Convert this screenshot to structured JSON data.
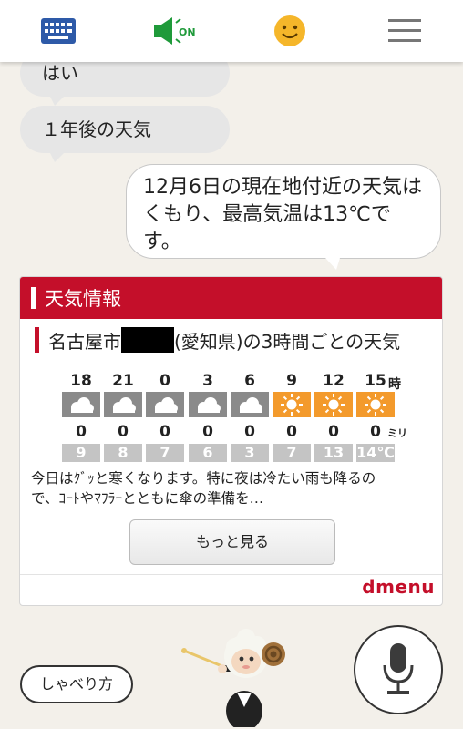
{
  "top_bar": {
    "icons": [
      "keyboard-icon",
      "speaker-icon",
      "smiley-icon",
      "hamburger-menu-icon"
    ],
    "speaker_state": "ON"
  },
  "conversation": {
    "user_bubble_1": "はい",
    "user_bubble_2": "１年後の天気",
    "reply_line_1": "12月6日の現在地付近の天気は",
    "reply_line_2": "くもり、最高気温は13℃で",
    "reply_line_3": "す。"
  },
  "weather_card": {
    "header": "天気情報",
    "city_prefix": "名古屋市",
    "city_suffix": "(愛知県)の3時間ごとの天気",
    "hour_unit": "時",
    "rain_unit": "ミリ",
    "hours": [
      "18",
      "21",
      "0",
      "3",
      "6",
      "9",
      "12",
      "15"
    ],
    "conditions": [
      "cloudy",
      "cloudy",
      "cloudy",
      "cloudy",
      "cloudy",
      "sunny",
      "sunny",
      "sunny"
    ],
    "rain": [
      "0",
      "0",
      "0",
      "0",
      "0",
      "0",
      "0",
      "0"
    ],
    "temps": [
      "9",
      "8",
      "7",
      "6",
      "3",
      "7",
      "13",
      "14℃"
    ],
    "description_line_1": "今日はｸﾞｯと寒くなります。特に夜は冷たい雨も降るの",
    "description_line_2": "で、ｺｰﾄやﾏﾌﾗｰとともに傘の準備を…",
    "more_button": "もっと見る",
    "brand": "dmenu",
    "colors": {
      "header": "#c40f2a",
      "cloudy": "#8a8a8a",
      "sunny": "#f39a2c"
    }
  },
  "bottom": {
    "howto_button": "しゃべり方",
    "mic_icon": "microphone-icon",
    "mascot": "sheep-mascot"
  }
}
